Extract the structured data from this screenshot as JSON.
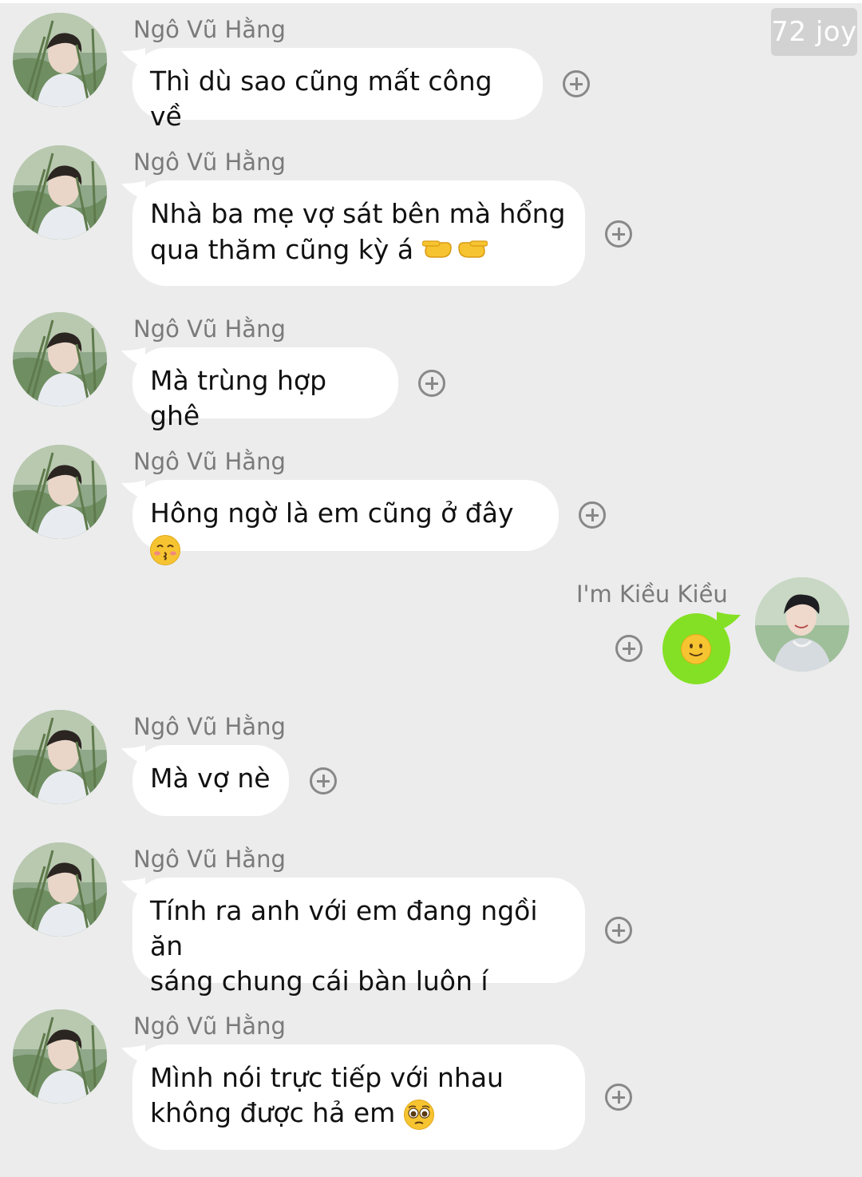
{
  "watermark": "72 joy",
  "colors": {
    "background": "#ececec",
    "incoming_bubble": "#ffffff",
    "outgoing_bubble": "#84e024",
    "sender_text": "#7a7a7a"
  },
  "messages": [
    {
      "sender": "Ngô Vũ Hằng",
      "lines": [
        "Thì dù sao cũng mất công về"
      ],
      "direction": "incoming"
    },
    {
      "sender": "Ngô Vũ Hằng",
      "lines": [
        "Nhà ba mẹ vợ sát bên mà hổng",
        "qua thăm cũng kỳ á"
      ],
      "emoji": "pointing-hands-emoji",
      "direction": "incoming"
    },
    {
      "sender": "Ngô Vũ Hằng",
      "lines": [
        "Mà trùng hợp ghê"
      ],
      "direction": "incoming"
    },
    {
      "sender": "Ngô Vũ Hằng",
      "lines": [
        "Hông ngờ là em cũng ở đây"
      ],
      "emoji": "kissing-face-emoji",
      "direction": "incoming"
    },
    {
      "sender": "I'm Kiều Kiều",
      "lines": [],
      "emoji": "smiling-face-emoji",
      "direction": "outgoing"
    },
    {
      "sender": "Ngô Vũ Hằng",
      "lines": [
        "Mà vợ nè"
      ],
      "direction": "incoming"
    },
    {
      "sender": "Ngô Vũ Hằng",
      "lines": [
        "Tính ra anh với em đang ngồi ăn",
        "sáng chung cái bàn luôn í"
      ],
      "direction": "incoming"
    },
    {
      "sender": "Ngô Vũ Hằng",
      "lines": [
        "Mình nói trực tiếp với nhau",
        "không được hả em"
      ],
      "emoji": "pleading-face-emoji",
      "direction": "incoming"
    }
  ]
}
